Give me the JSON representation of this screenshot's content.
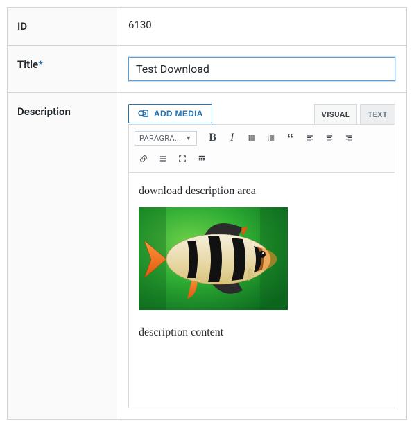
{
  "rows": {
    "id": {
      "label": "ID",
      "value": "6130"
    },
    "title": {
      "label": "Title",
      "required": "*",
      "value": "Test Download"
    },
    "description": {
      "label": "Description"
    }
  },
  "editor": {
    "add_media": "ADD MEDIA",
    "tabs": {
      "visual": "VISUAL",
      "text": "TEXT"
    },
    "format_dropdown": "PARAGRA...",
    "content": {
      "line1": "download description area",
      "line2": "description content"
    }
  }
}
